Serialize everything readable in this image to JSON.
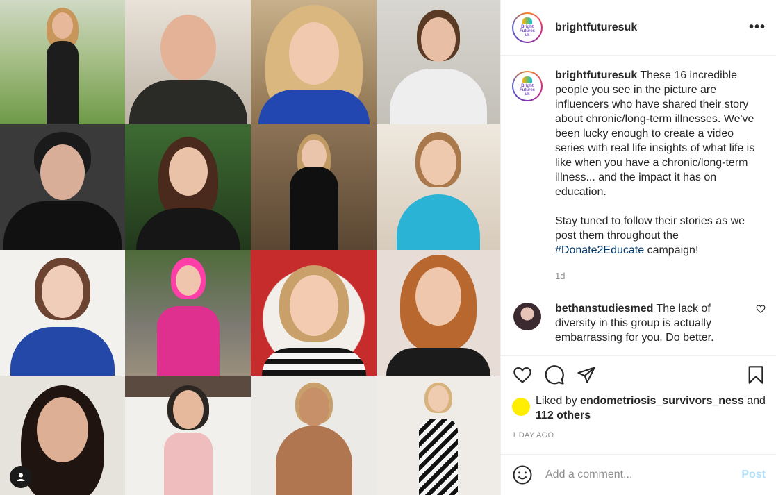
{
  "post": {
    "username": "brightfuturesuk",
    "more_label": "•••",
    "logo": {
      "line1": "Bright",
      "line2": "Futures",
      "line3": "uk"
    },
    "caption_text": "These 16 incredible people you see in the picture are influencers who have shared their story about chronic/long-term illnesses. We've been lucky enough to create a video series with real life insights of what life is like when you have a chronic/long-term illness... and the impact it has on education.",
    "caption_text2_before": "Stay tuned to follow their stories as we post them throughout the",
    "hashtag": "#Donate2Educate",
    "caption_text2_after": "campaign!",
    "caption_time": "1d"
  },
  "comment": {
    "username": "bethanstudiesmed",
    "text": "The lack of diversity in this group is actually embarrassing for you. Do better."
  },
  "likes": {
    "prefix": "Liked by",
    "user": "endometriosis_survivors_ness",
    "and": "and",
    "others": "112 others"
  },
  "posted_time": "1 DAY AGO",
  "add_comment": {
    "placeholder": "Add a comment...",
    "post_label": "Post"
  },
  "icons": {
    "like": "heart-icon",
    "comment": "comment-icon",
    "share": "share-icon",
    "save": "bookmark-icon",
    "emoji": "emoji-icon",
    "more": "more-icon",
    "user": "user-icon"
  },
  "colors": {
    "link": "#00376b",
    "muted": "#8e8e8e",
    "post_disabled": "#b2dffc",
    "text": "#262626"
  }
}
